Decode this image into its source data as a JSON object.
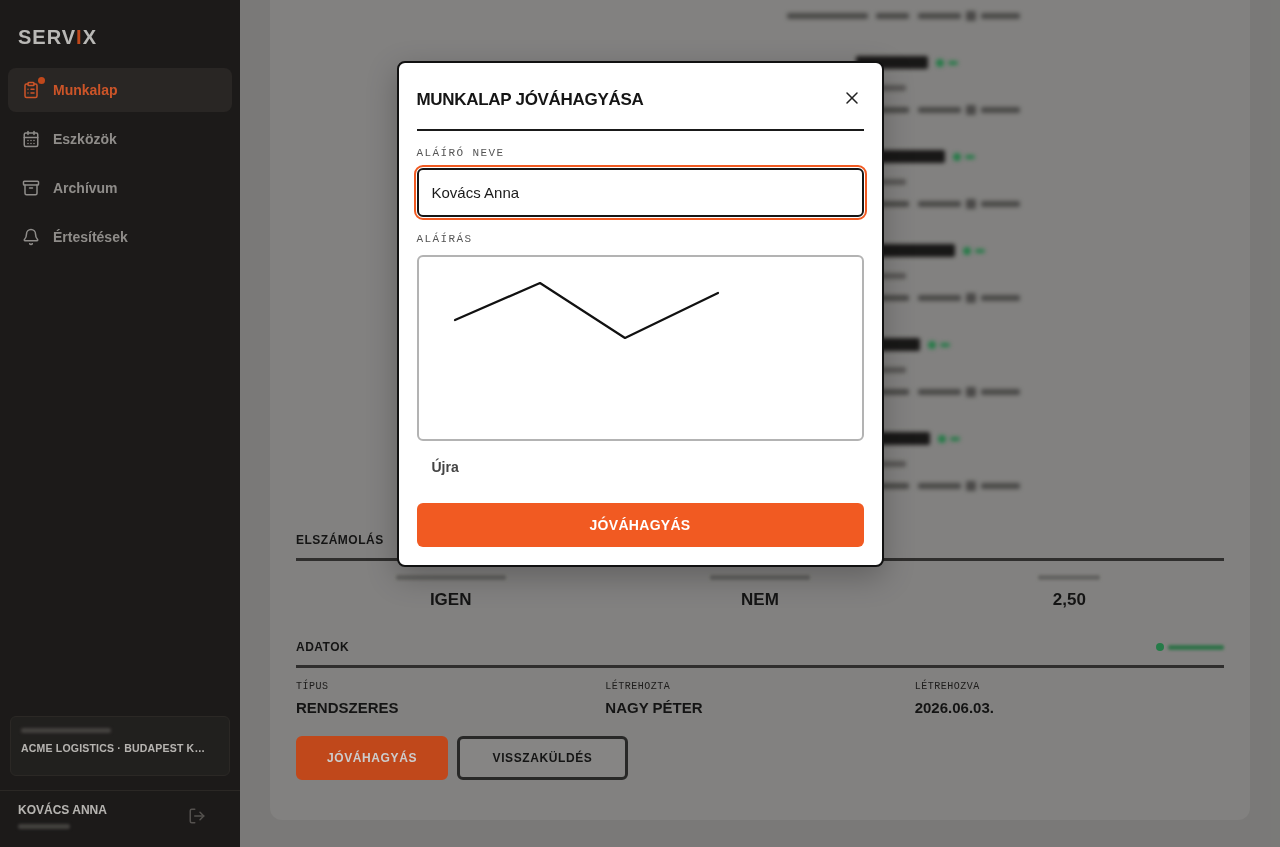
{
  "sidebar": {
    "logo": [
      {
        "text": "SERV",
        "accent": false
      },
      {
        "text": "I",
        "accent": true
      },
      {
        "text": "X",
        "accent": false
      }
    ],
    "nav_items": [
      {
        "label": "Munkalap",
        "kind": "clipboard",
        "selected": true,
        "badge": true
      },
      {
        "label": "Eszközök",
        "kind": "calendar",
        "selected": false,
        "badge": false
      },
      {
        "label": "Archívum",
        "kind": "archive",
        "selected": false,
        "badge": false
      },
      {
        "label": "Értesítések",
        "kind": "bell",
        "selected": false,
        "badge": false
      }
    ],
    "company": {
      "name": "ACME LOGISTICS · BUDAPEST K…"
    },
    "user": {
      "name": "KOVÁCS ANNA"
    }
  },
  "work_order": {
    "billing": {
      "title": "ELSZÁMOLÁS",
      "values": [
        "IGEN",
        "NEM",
        "2,50"
      ]
    },
    "details": {
      "title": "ADATOK",
      "fields": [
        {
          "label": "TÍPUS",
          "value": "RENDSZERES"
        },
        {
          "label": "LÉTREHOZTA",
          "value": "NAGY PÉTER"
        },
        {
          "label": "LÉTREHOZVA",
          "value": "2026.06.03."
        }
      ]
    },
    "actions": [
      {
        "label": "JÓVÁHAGYÁS",
        "kind": "primary"
      },
      {
        "label": "VISSZAKÜLDÉS",
        "kind": "secondary"
      }
    ]
  },
  "modal": {
    "title": "MUNKALAP JÓVÁHAGYÁSA",
    "name_label": "ALÁÍRÓ NEVE",
    "name_value": "Kovács Anna",
    "name_focused": true,
    "signature_label": "ALÁÍRÁS",
    "signature": {
      "signed": true
    },
    "reset_label": "Újra",
    "submit_label": "JÓVÁHAGYÁS"
  }
}
